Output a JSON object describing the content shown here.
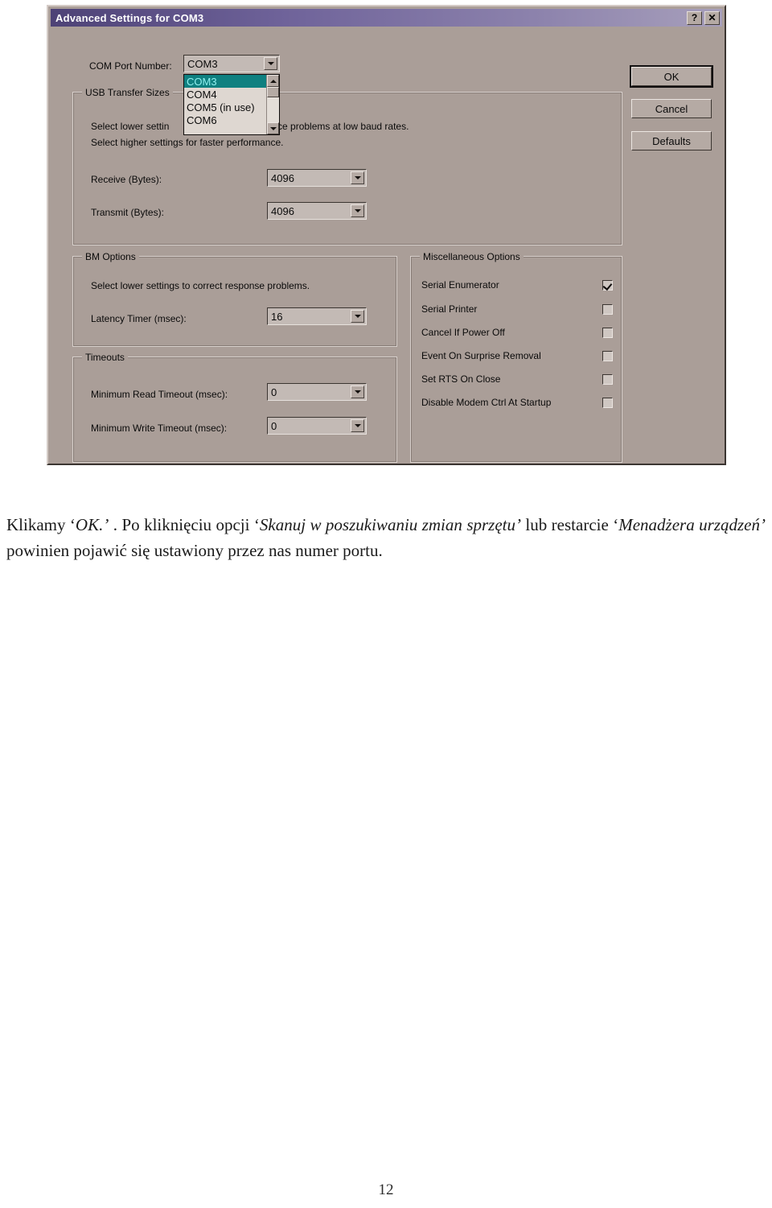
{
  "page": {
    "page_number": "12",
    "caption_parts": {
      "p1": "Klikamy ‘",
      "p2": "OK.’",
      "p3": " . Po kliknięciu opcji ‘",
      "p4": "Skanuj w poszukiwaniu zmian sprzętu’",
      "p5": " lub restarcie ‘",
      "p6": "Menadżera urządzeń’",
      "p7": " powinien pojawić się ustawiony przez nas numer portu."
    }
  },
  "dialog": {
    "title": "Advanced Settings for COM3",
    "titlebar_buttons": [
      {
        "name": "help-button",
        "glyph": "?"
      },
      {
        "name": "close-button",
        "glyph": "✕"
      }
    ],
    "com_port": {
      "label": "COM Port Number:",
      "value": "COM3",
      "dropdown_open": true,
      "options": [
        {
          "label": "COM3",
          "selected": true
        },
        {
          "label": "COM4",
          "selected": false
        },
        {
          "label": "COM5 (in use)",
          "selected": false
        },
        {
          "label": "COM6",
          "selected": false
        }
      ]
    },
    "usb_transfer_sizes": {
      "title": "USB Transfer Sizes",
      "hint_line_1": "Select lower settings to correct performance problems at low baud rates.",
      "hint_line_1_visible_left": "Select lower settin",
      "hint_line_1_visible_right": "hance problems at low baud rates.",
      "hint_line_2": "Select higher settings for faster performance.",
      "receive_label": "Receive (Bytes):",
      "receive_value": "4096",
      "transmit_label": "Transmit (Bytes):",
      "transmit_value": "4096"
    },
    "bm_options": {
      "title": "BM Options",
      "hint": "Select lower settings to correct response problems.",
      "latency_label": "Latency Timer (msec):",
      "latency_value": "16"
    },
    "timeouts": {
      "title": "Timeouts",
      "min_read_label": "Minimum Read Timeout (msec):",
      "min_read_value": "0",
      "min_write_label": "Minimum Write Timeout (msec):",
      "min_write_value": "0"
    },
    "misc_options": {
      "title": "Miscellaneous Options",
      "items": [
        {
          "label": "Serial Enumerator",
          "checked": true
        },
        {
          "label": "Serial Printer",
          "checked": false
        },
        {
          "label": "Cancel If Power Off",
          "checked": false
        },
        {
          "label": "Event On Surprise Removal",
          "checked": false
        },
        {
          "label": "Set RTS On Close",
          "checked": false
        },
        {
          "label": "Disable Modem Ctrl At Startup",
          "checked": false
        }
      ]
    },
    "buttons": {
      "ok": "OK",
      "cancel": "Cancel",
      "defaults": "Defaults"
    },
    "colors": {
      "dialog_face": "#aa9e98",
      "titlebar_active": "#6f639a",
      "selection_highlight": "#0f8080",
      "selection_text": "#90f0ef",
      "field_face": "#c3bab5"
    }
  }
}
